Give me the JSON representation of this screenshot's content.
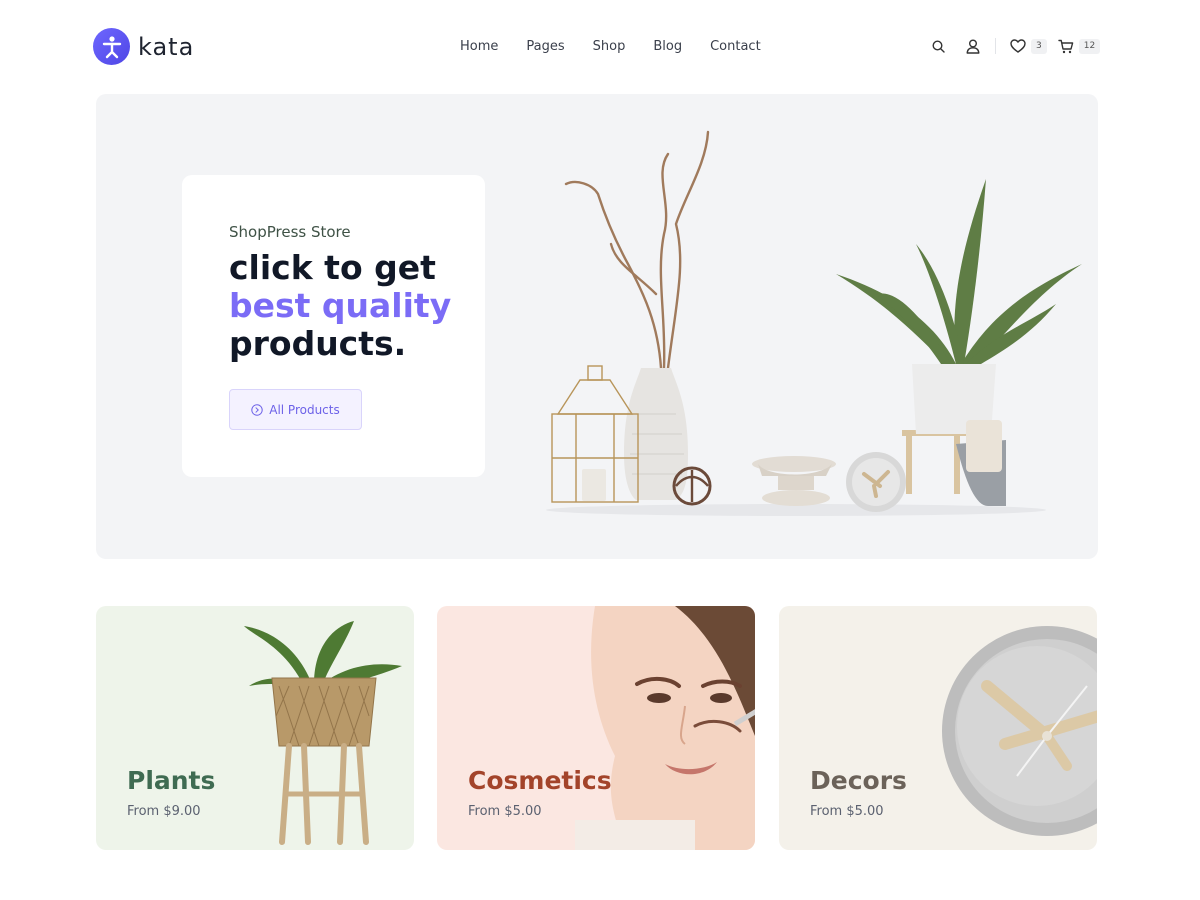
{
  "brand": {
    "name": "kata",
    "accent": "#6366f1"
  },
  "nav": {
    "items": [
      "Home",
      "Pages",
      "Shop",
      "Blog",
      "Contact"
    ]
  },
  "header_icons": {
    "search": "search-icon",
    "account": "user-icon",
    "wishlist": "heart-icon",
    "wishlist_count": "3",
    "cart": "cart-icon",
    "cart_count": "12"
  },
  "hero": {
    "eyebrow": "ShopPress Store",
    "line1": "click to get",
    "line2": "best quality",
    "line3": "products.",
    "cta_label": "All Products",
    "highlight_color": "#7b6cf6"
  },
  "categories": [
    {
      "title": "Plants",
      "price": "From $9.00",
      "bg": "#eef4ea",
      "title_color": "#3f6b52"
    },
    {
      "title": "Cosmetics",
      "price": "From $5.00",
      "bg": "#fbe7e1",
      "title_color": "#a3442a"
    },
    {
      "title": "Decors",
      "price": "From $5.00",
      "bg": "#f4f1ea",
      "title_color": "#6b6259"
    }
  ]
}
